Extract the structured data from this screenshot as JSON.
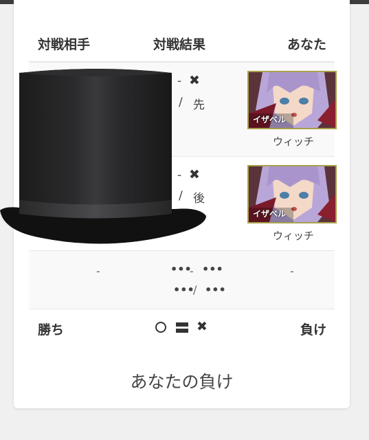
{
  "headers": {
    "opponent": "対戦相手",
    "result": "対戦結果",
    "you": "あなた"
  },
  "matches": [
    {
      "result_sep": "-",
      "result_mark": "✖",
      "turn_sep": "/",
      "turn": "先",
      "your_card_label": "イザベル",
      "your_class": "ウィッチ"
    },
    {
      "result_sep": "-",
      "result_mark": "✖",
      "turn_sep": "/",
      "turn": "後",
      "your_card_label": "イザベル",
      "your_class": "ウィッチ"
    },
    {
      "opponent": "-",
      "you": "-",
      "result_left": "•••",
      "result_sep": "-",
      "result_right": "•••",
      "turn_left": "•••",
      "turn_sep": "/",
      "turn_right": "•••"
    }
  ],
  "footer": {
    "win": "勝ち",
    "lose": "負け",
    "mark_o": "○",
    "mark_eq": "〓",
    "mark_x": "✖"
  },
  "verdict": "あなたの負け",
  "colors": {
    "accent_gold": "#a8a04a",
    "hair": "#b9a6d8",
    "card_bg": "#ffffff",
    "top_bar": "#3d3d3d"
  },
  "overlay_icon": "top-hat-icon"
}
